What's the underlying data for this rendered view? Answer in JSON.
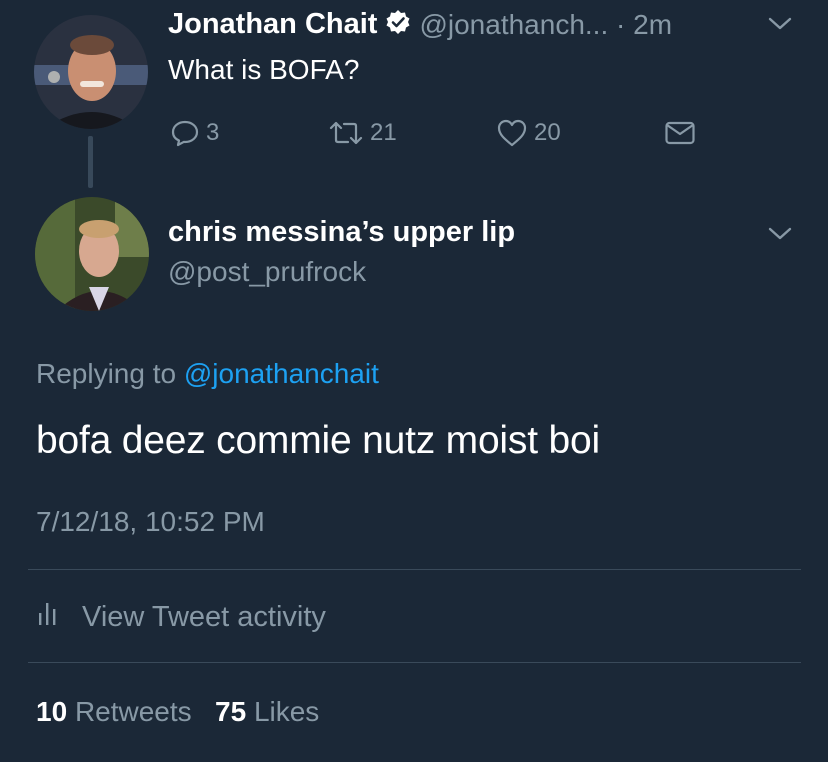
{
  "parent_tweet": {
    "author_name": "Jonathan Chait",
    "handle_time": "@jonathanch... · 2m",
    "text": "What is BOFA?",
    "replies": "3",
    "retweets": "21",
    "likes": "20",
    "verified": true
  },
  "reply_tweet": {
    "author_name": "chris messina’s upper lip",
    "handle": "@post_prufrock",
    "replying_prefix": "Replying to",
    "replying_handle": "@jonathanchait",
    "text": "bofa deez commie nutz moist boi",
    "timestamp": "7/12/18, 10:52 PM",
    "activity_label": "View Tweet activity",
    "retweet_count": "10",
    "retweet_label": "Retweets",
    "like_count": "75",
    "like_label": "Likes"
  },
  "colors": {
    "background": "#1b2837",
    "muted": "#8899a6",
    "link": "#1da1f2",
    "divider": "#3a4a5a"
  },
  "icons": [
    "verified-badge-icon",
    "chevron-down-icon",
    "reply-icon",
    "retweet-icon",
    "like-icon",
    "direct-message-icon",
    "activity-bars-icon"
  ]
}
